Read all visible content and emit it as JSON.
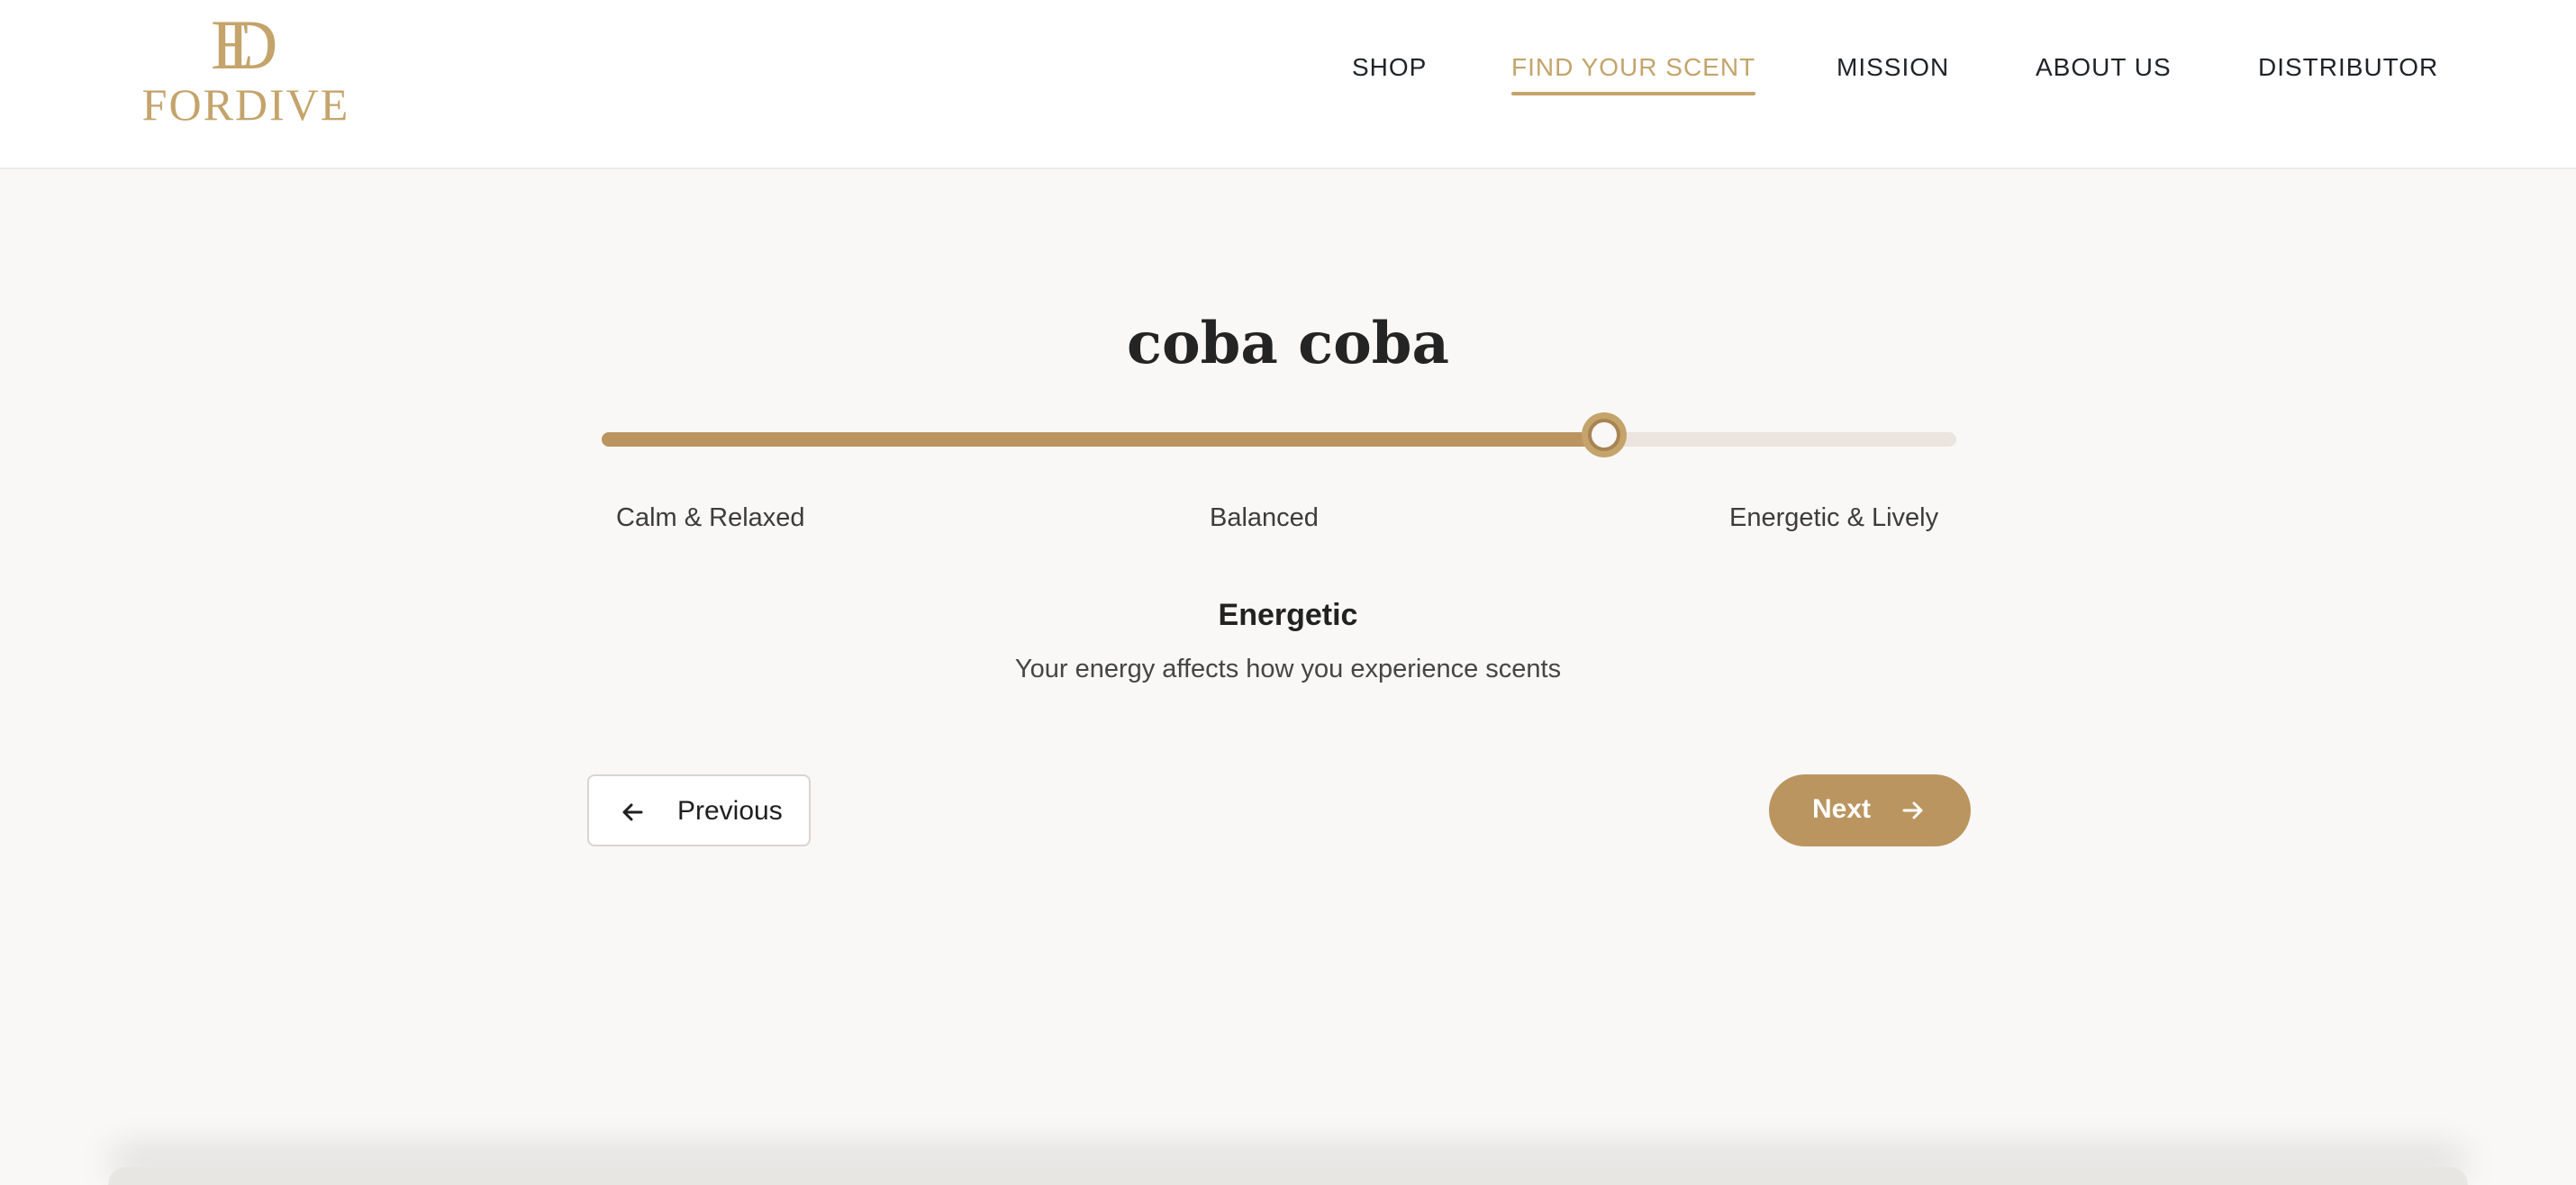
{
  "brand": {
    "monogram_1": "E",
    "monogram_2": "D",
    "name": "FORDIVE",
    "accent": "#c4a46b"
  },
  "nav": {
    "items": [
      {
        "label": "SHOP",
        "active": false
      },
      {
        "label": "FIND YOUR SCENT",
        "active": true
      },
      {
        "label": "MISSION",
        "active": false
      },
      {
        "label": "ABOUT US",
        "active": false
      },
      {
        "label": "DISTRIBUTOR",
        "active": false
      }
    ]
  },
  "quiz": {
    "title": "coba coba",
    "slider": {
      "value_fraction": 0.74,
      "labels": {
        "min": "Calm & Relaxed",
        "mid": "Balanced",
        "max": "Energetic & Lively"
      }
    },
    "level": {
      "title": "Energetic",
      "description": "Your energy affects how you experience scents"
    },
    "previous_label": "Previous",
    "next_label": "Next"
  },
  "icons": {
    "previous": "arrow-left-icon",
    "next": "arrow-right-icon"
  },
  "colors": {
    "fill": "#bb955f",
    "track": "#ece4de",
    "background": "#f9f8f6"
  }
}
